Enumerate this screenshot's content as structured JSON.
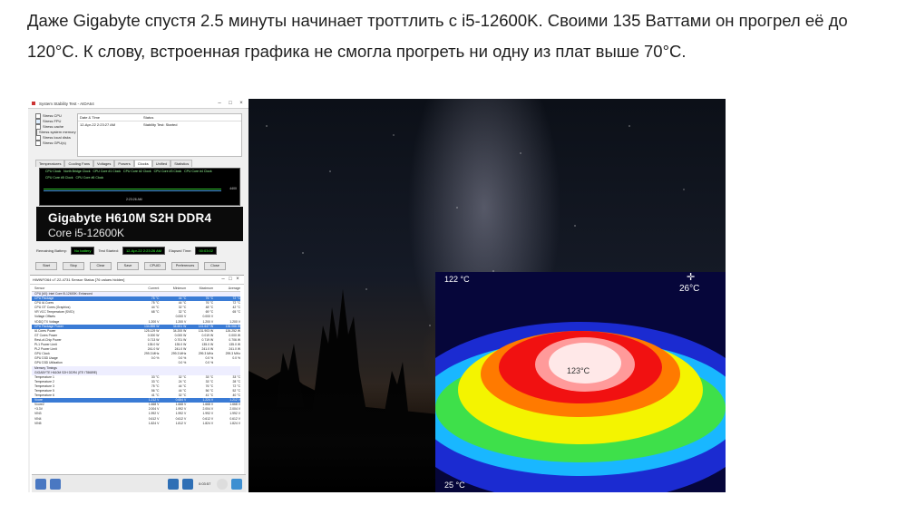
{
  "article": {
    "paragraph": "Даже Gigabyte спустя 2.5 минуты начинает троттлить с i5-12600K. Своими 135 Ваттами он прогрел её до 120°C. К слову, встроенная графика не смогла прогреть ни одну из плат выше 70°C."
  },
  "stability_test": {
    "window_title": "System Stability Test - AIDA64",
    "stress_items": [
      "Stress CPU",
      "Stress FPU",
      "Stress cache",
      "Stress system memory",
      "Stress local disks",
      "Stress GPU(s)"
    ],
    "log_headers": [
      "Date & Time",
      "Status"
    ],
    "log_rows": [
      [
        "12-Apr-22 2:23:27 AM",
        "Stability Test: Started"
      ]
    ],
    "tabs": [
      "Temperatures",
      "Cooling Fans",
      "Voltages",
      "Powers",
      "Clocks",
      "Unified",
      "Statistics"
    ],
    "active_tab": "Clocks",
    "graph_legend": [
      "CPU Clock",
      "North Bridge Clock",
      "CPU Core #1 Clock",
      "CPU Core #2 Clock",
      "CPU Core #3 Clock",
      "CPU Core #4 Clock",
      "CPU Core #5 Clock",
      "CPU Core #6 Clock"
    ],
    "graph_value": "4400",
    "graph_time": "2:23:26 AM",
    "banner_line1": "Gigabyte H610M S2H DDR4",
    "banner_line2": "Core i5-12600K",
    "remaining_battery_label": "Remaining Battery:",
    "remaining_battery_value": "No battery",
    "test_started_label": "Test Started:",
    "test_started_value": "12-Apr-22 2:23:26 AM",
    "elapsed_label": "Elapsed Time:",
    "elapsed_value": "00:03:02",
    "buttons": [
      "Start",
      "Stop",
      "Clear",
      "Save",
      "CPUID",
      "Preferences",
      "Close"
    ]
  },
  "hwinfo": {
    "title": "HWiNFO64 v7.22-4731 Sensor Status [76 values hidden]",
    "headers": [
      "Sensor",
      "Current",
      "Minimum",
      "Maximum",
      "Average"
    ],
    "rows": [
      {
        "name": "CPU [#0]: Intel Core i5-12600K: Enhanced",
        "v": [
          "",
          "",
          "",
          ""
        ],
        "type": "sec"
      },
      {
        "name": "CPU Package",
        "v": [
          "75 °C",
          "44 °C",
          "76 °C",
          "72 °C"
        ],
        "type": "sel"
      },
      {
        "name": "CPU IA Cores",
        "v": [
          "75 °C",
          "44 °C",
          "76 °C",
          "72 °C"
        ],
        "type": ""
      },
      {
        "name": "CPU GT Cores (Graphics)",
        "v": [
          "44 °C",
          "32 °C",
          "48 °C",
          "42 °C"
        ],
        "type": ""
      },
      {
        "name": "VR VCC Temperature (SVID)",
        "v": [
          "68 °C",
          "32 °C",
          "69 °C",
          "65 °C"
        ],
        "type": ""
      },
      {
        "name": "Voltage Offsets",
        "v": [
          "",
          "0.000 V",
          "0.000 V",
          ""
        ],
        "type": ""
      },
      {
        "name": "VDDQ TX Voltage",
        "v": [
          "1.200 V",
          "1.200 V",
          "1.200 V",
          "1.200 V"
        ],
        "type": ""
      },
      {
        "name": "CPU Package Power",
        "v": [
          "134.855 W",
          "34.601 W",
          "141.647 W",
          "136.066 W"
        ],
        "type": "sel"
      },
      {
        "name": "IA Cores Power",
        "v": [
          "125.129 W",
          "34.200 W",
          "131.903 W",
          "126.252 W"
        ],
        "type": ""
      },
      {
        "name": "GT Cores Power",
        "v": [
          "0.000 W",
          "0.000 W",
          "0.019 W",
          "0.000 W"
        ],
        "type": ""
      },
      {
        "name": "Rest-of-Chip Power",
        "v": [
          "0.713 W",
          "0.701 W",
          "0.719 W",
          "0.706 W"
        ],
        "type": ""
      },
      {
        "name": "PL1 Power Limit",
        "v": [
          "135.0 W",
          "135.0 W",
          "135.0 W",
          "135.0 W"
        ],
        "type": ""
      },
      {
        "name": "PL2 Power Limit",
        "v": [
          "241.0 W",
          "241.0 W",
          "241.0 W",
          "241.0 W"
        ],
        "type": ""
      },
      {
        "name": "GPU Clock",
        "v": [
          "299.3 MHz",
          "299.3 MHz",
          "299.3 MHz",
          "299.3 MHz"
        ],
        "type": ""
      },
      {
        "name": "GPU D3D Usage",
        "v": [
          "0.0 %",
          "0.0 %",
          "0.0 %",
          "0.0 %"
        ],
        "type": ""
      },
      {
        "name": "GPU D3D Utilization",
        "v": [
          "",
          "0.0 %",
          "0.0 %",
          ""
        ],
        "type": ""
      },
      {
        "name": "Memory Timings",
        "v": [
          "",
          "",
          "",
          ""
        ],
        "type": "sec"
      },
      {
        "name": "GIGABYTE H610M S2H DDR4 (ITE IT8689E)",
        "v": [
          "",
          "",
          "",
          ""
        ],
        "type": "sec"
      },
      {
        "name": "Temperature 1",
        "v": [
          "33 °C",
          "32 °C",
          "33 °C",
          "33 °C"
        ],
        "type": ""
      },
      {
        "name": "Temperature 2",
        "v": [
          "33 °C",
          "24 °C",
          "33 °C",
          "28 °C"
        ],
        "type": ""
      },
      {
        "name": "Temperature 3",
        "v": [
          "75 °C",
          "44 °C",
          "76 °C",
          "72 °C"
        ],
        "type": ""
      },
      {
        "name": "Temperature 5",
        "v": [
          "56 °C",
          "44 °C",
          "56 °C",
          "52 °C"
        ],
        "type": ""
      },
      {
        "name": "Temperature 6",
        "v": [
          "41 °C",
          "32 °C",
          "41 °C",
          "40 °C"
        ],
        "type": ""
      },
      {
        "name": "Vcore",
        "v": [
          "1.212 V",
          "0.684 V",
          "1.224 V",
          "1.212 V"
        ],
        "type": "sel"
      },
      {
        "name": "Vcore2",
        "v": [
          "1.668 V",
          "1.668 V",
          "1.668 V",
          "1.668 V"
        ],
        "type": ""
      },
      {
        "name": "+3.3V",
        "v": [
          "2.004 V",
          "1.992 V",
          "2.004 V",
          "2.004 V"
        ],
        "type": ""
      },
      {
        "name": "VIN3",
        "v": [
          "1.992 V",
          "1.992 V",
          "1.992 V",
          "1.992 V"
        ],
        "type": ""
      },
      {
        "name": "VIN4",
        "v": [
          "0.612 V",
          "0.612 V",
          "0.612 V",
          "0.612 V"
        ],
        "type": ""
      },
      {
        "name": "VIN5",
        "v": [
          "1.824 V",
          "1.812 V",
          "1.824 V",
          "1.824 V"
        ],
        "type": ""
      }
    ],
    "clock": "0:03:57"
  },
  "thermal": {
    "max_label": "122 °C",
    "min_label": "25 °C",
    "spot_label": "26°C",
    "center_label": "123°C"
  }
}
